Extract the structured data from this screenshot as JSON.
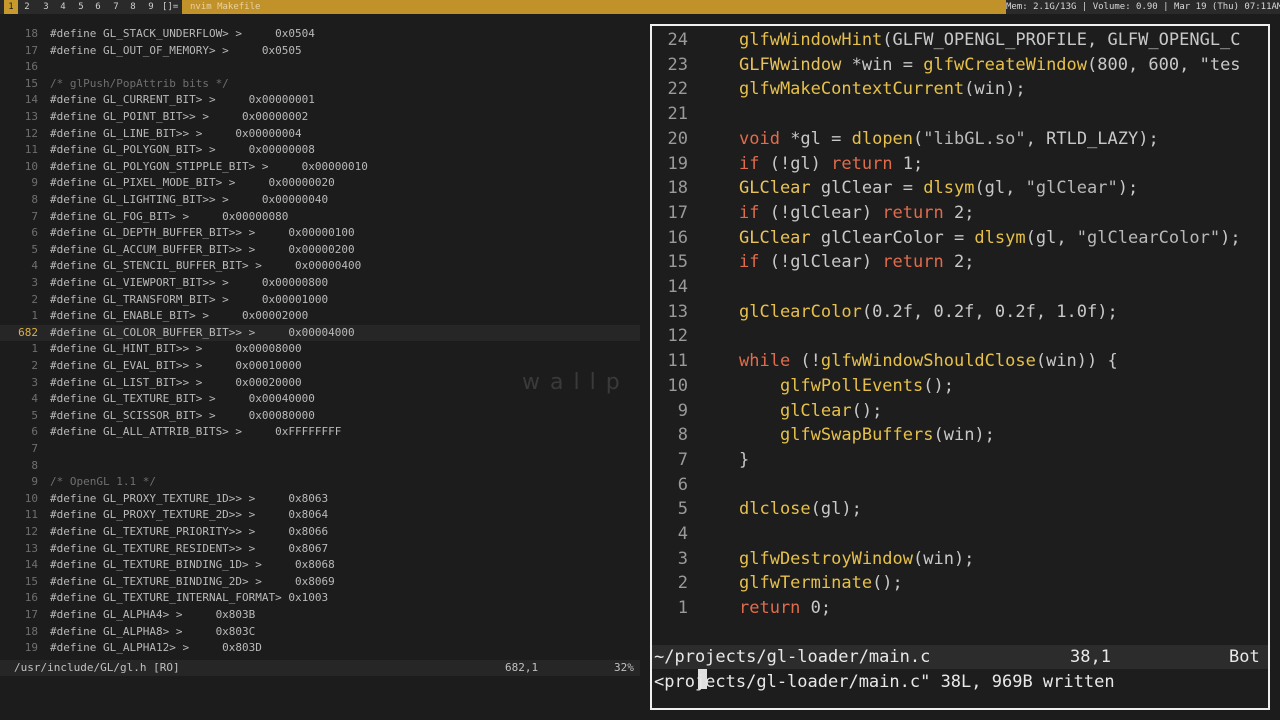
{
  "topbar": {
    "layout_symbol": "[]=",
    "window_title": "nvim Makefile",
    "system_info": "Mem: 2.1G/13G | Volume: 0.90 | Mar 19 (Thu) 07:11AM"
  },
  "workspaces": [
    "1",
    "2",
    "3",
    "4",
    "5",
    "6",
    "7",
    "8",
    "9"
  ],
  "left_pane": {
    "lines": [
      {
        "n": "18",
        "t": "#define GL_STACK_UNDERFLOW> >     0x0504",
        "k": "def"
      },
      {
        "n": "17",
        "t": "#define GL_OUT_OF_MEMORY> >     0x0505",
        "k": "def"
      },
      {
        "n": "16",
        "t": "",
        "k": "blank"
      },
      {
        "n": "15",
        "t": "/* glPush/PopAttrib bits */",
        "k": "cmt"
      },
      {
        "n": "14",
        "t": "#define GL_CURRENT_BIT> >     0x00000001",
        "k": "def"
      },
      {
        "n": "13",
        "t": "#define GL_POINT_BIT>> >     0x00000002",
        "k": "def"
      },
      {
        "n": "12",
        "t": "#define GL_LINE_BIT>> >     0x00000004",
        "k": "def"
      },
      {
        "n": "11",
        "t": "#define GL_POLYGON_BIT> >     0x00000008",
        "k": "def"
      },
      {
        "n": "10",
        "t": "#define GL_POLYGON_STIPPLE_BIT> >     0x00000010",
        "k": "def"
      },
      {
        "n": "9",
        "t": "#define GL_PIXEL_MODE_BIT> >     0x00000020",
        "k": "def"
      },
      {
        "n": "8",
        "t": "#define GL_LIGHTING_BIT>> >     0x00000040",
        "k": "def"
      },
      {
        "n": "7",
        "t": "#define GL_FOG_BIT> >     0x00000080",
        "k": "def"
      },
      {
        "n": "6",
        "t": "#define GL_DEPTH_BUFFER_BIT>> >     0x00000100",
        "k": "def"
      },
      {
        "n": "5",
        "t": "#define GL_ACCUM_BUFFER_BIT>> >     0x00000200",
        "k": "def"
      },
      {
        "n": "4",
        "t": "#define GL_STENCIL_BUFFER_BIT> >     0x00000400",
        "k": "def"
      },
      {
        "n": "3",
        "t": "#define GL_VIEWPORT_BIT>> >     0x00000800",
        "k": "def"
      },
      {
        "n": "2",
        "t": "#define GL_TRANSFORM_BIT> >     0x00001000",
        "k": "def"
      },
      {
        "n": "1",
        "t": "#define GL_ENABLE_BIT> >     0x00002000",
        "k": "def"
      },
      {
        "n": "682",
        "t": "#define GL_COLOR_BUFFER_BIT>> >     0x00004000",
        "k": "cur"
      },
      {
        "n": "1",
        "t": "#define GL_HINT_BIT>> >     0x00008000",
        "k": "def"
      },
      {
        "n": "2",
        "t": "#define GL_EVAL_BIT>> >     0x00010000",
        "k": "def"
      },
      {
        "n": "3",
        "t": "#define GL_LIST_BIT>> >     0x00020000",
        "k": "def"
      },
      {
        "n": "4",
        "t": "#define GL_TEXTURE_BIT> >     0x00040000",
        "k": "def"
      },
      {
        "n": "5",
        "t": "#define GL_SCISSOR_BIT> >     0x00080000",
        "k": "def"
      },
      {
        "n": "6",
        "t": "#define GL_ALL_ATTRIB_BITS> >     0xFFFFFFFF",
        "k": "def"
      },
      {
        "n": "7",
        "t": "",
        "k": "blank"
      },
      {
        "n": "8",
        "t": "",
        "k": "blank"
      },
      {
        "n": "9",
        "t": "/* OpenGL 1.1 */",
        "k": "cmt"
      },
      {
        "n": "10",
        "t": "#define GL_PROXY_TEXTURE_1D>> >     0x8063",
        "k": "def"
      },
      {
        "n": "11",
        "t": "#define GL_PROXY_TEXTURE_2D>> >     0x8064",
        "k": "def"
      },
      {
        "n": "12",
        "t": "#define GL_TEXTURE_PRIORITY>> >     0x8066",
        "k": "def"
      },
      {
        "n": "13",
        "t": "#define GL_TEXTURE_RESIDENT>> >     0x8067",
        "k": "def"
      },
      {
        "n": "14",
        "t": "#define GL_TEXTURE_BINDING_1D> >     0x8068",
        "k": "def"
      },
      {
        "n": "15",
        "t": "#define GL_TEXTURE_BINDING_2D> >     0x8069",
        "k": "def"
      },
      {
        "n": "16",
        "t": "#define GL_TEXTURE_INTERNAL_FORMAT> 0x1003",
        "k": "def"
      },
      {
        "n": "17",
        "t": "#define GL_ALPHA4> >     0x803B",
        "k": "def"
      },
      {
        "n": "18",
        "t": "#define GL_ALPHA8> >     0x803C",
        "k": "def"
      },
      {
        "n": "19",
        "t": "#define GL_ALPHA12> >     0x803D",
        "k": "def"
      }
    ],
    "status": {
      "file": "/usr/include/GL/gl.h [RO]",
      "position": "682,1",
      "percent": "32%"
    },
    "watermark": "wallp"
  },
  "right_pane": {
    "lines": [
      {
        "n": "24",
        "t": "glfwWindowHint(GLFW_OPENGL_PROFILE, GLFW_OPENGL_C"
      },
      {
        "n": "23",
        "t": "GLFWwindow *win = glfwCreateWindow(800, 600, \"tes"
      },
      {
        "n": "22",
        "t": "glfwMakeContextCurrent(win);"
      },
      {
        "n": "21",
        "t": ""
      },
      {
        "n": "20",
        "t": "void *gl = dlopen(\"libGL.so\", RTLD_LAZY);"
      },
      {
        "n": "19",
        "t": "if (!gl) return 1;"
      },
      {
        "n": "18",
        "t": "GLClear glClear = dlsym(gl, \"glClear\");"
      },
      {
        "n": "17",
        "t": "if (!glClear) return 2;"
      },
      {
        "n": "16",
        "t": "GLClear glClearColor = dlsym(gl, \"glClearColor\");"
      },
      {
        "n": "15",
        "t": "if (!glClear) return 2;"
      },
      {
        "n": "14",
        "t": ""
      },
      {
        "n": "13",
        "t": "glClearColor(0.2f, 0.2f, 0.2f, 1.0f);"
      },
      {
        "n": "12",
        "t": ""
      },
      {
        "n": "11",
        "t": "while (!glfwWindowShouldClose(win)) {"
      },
      {
        "n": "10",
        "t": "    glfwPollEvents();"
      },
      {
        "n": "9",
        "t": "    glClear();"
      },
      {
        "n": "8",
        "t": "    glfwSwapBuffers(win);"
      },
      {
        "n": "7",
        "t": "}"
      },
      {
        "n": "6",
        "t": ""
      },
      {
        "n": "5",
        "t": "dlclose(gl);"
      },
      {
        "n": "4",
        "t": ""
      },
      {
        "n": "3",
        "t": "glfwDestroyWindow(win);"
      },
      {
        "n": "2",
        "t": "glfwTerminate();"
      },
      {
        "n": "1",
        "t": "return 0;"
      }
    ],
    "cursor_line_number": "38",
    "status": {
      "file": "~/projects/gl-loader/main.c",
      "position": "38,1",
      "scroll": "Bot"
    },
    "command_line": "<projects/gl-loader/main.c\" 38L, 969B written"
  }
}
